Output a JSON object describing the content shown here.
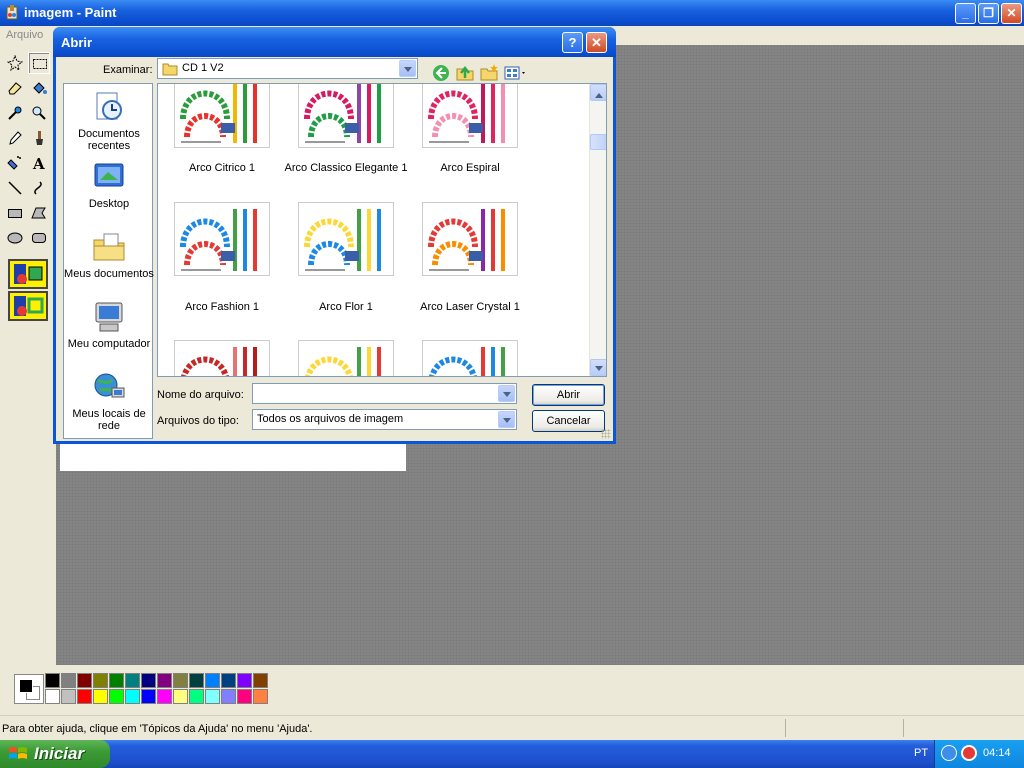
{
  "paint": {
    "title": "imagem - Paint",
    "menu_file": "Arquivo",
    "status": "Para obter ajuda, clique em 'Tópicos da Ajuda' no menu 'Ajuda'."
  },
  "palette": {
    "top_row": [
      "#000000",
      "#808080",
      "#800000",
      "#808000",
      "#008000",
      "#008080",
      "#000080",
      "#800080",
      "#808040",
      "#004040",
      "#0080ff",
      "#004080",
      "#8000ff",
      "#804000"
    ],
    "bottom_row": [
      "#ffffff",
      "#c0c0c0",
      "#ff0000",
      "#ffff00",
      "#00ff00",
      "#00ffff",
      "#0000ff",
      "#ff00ff",
      "#ffff80",
      "#00ff80",
      "#80ffff",
      "#8080ff",
      "#ff0080",
      "#ff8040"
    ]
  },
  "dialog": {
    "title": "Abrir",
    "look_in_label": "Examinar:",
    "look_in_value": "CD 1 V2",
    "places": [
      {
        "label": "Documentos recentes",
        "icon": "recent-documents-icon"
      },
      {
        "label": "Desktop",
        "icon": "desktop-icon"
      },
      {
        "label": "Meus documentos",
        "icon": "my-documents-icon"
      },
      {
        "label": "Meu computador",
        "icon": "my-computer-icon"
      },
      {
        "label": "Meus locais de rede",
        "icon": "network-places-icon"
      }
    ],
    "files": [
      {
        "name": "Arco Citrico 1",
        "colors": [
          "#2a9d3a",
          "#e8312b",
          "#f2b705"
        ]
      },
      {
        "name": "Arco Classico Elegante 1",
        "colors": [
          "#d81b60",
          "#1e9e45",
          "#8e44ad"
        ]
      },
      {
        "name": "Arco Espiral",
        "colors": [
          "#e0245e",
          "#f48fb1",
          "#c2185b"
        ]
      },
      {
        "name": "Arco Fashion 1",
        "colors": [
          "#1e88e5",
          "#e53935",
          "#43a047"
        ]
      },
      {
        "name": "Arco Flor 1",
        "colors": [
          "#fdd835",
          "#1e88e5",
          "#43a047"
        ]
      },
      {
        "name": "Arco Laser Crystal 1",
        "colors": [
          "#e53935",
          "#fb8c00",
          "#8e24aa"
        ]
      },
      {
        "name": "",
        "colors": [
          "#c62828",
          "#b71c1c",
          "#e57373"
        ]
      },
      {
        "name": "",
        "colors": [
          "#fdd835",
          "#e53935",
          "#43a047"
        ]
      },
      {
        "name": "",
        "colors": [
          "#1e88e5",
          "#43a047",
          "#e53935"
        ]
      }
    ],
    "filename_label": "Nome do arquivo:",
    "filename_value": "",
    "filetype_label": "Arquivos do tipo:",
    "filetype_value": "Todos os arquivos de imagem",
    "open_button": "Abrir",
    "cancel_button": "Cancelar"
  },
  "taskbar": {
    "start": "Iniciar",
    "language": "PT",
    "clock": "04:14"
  }
}
